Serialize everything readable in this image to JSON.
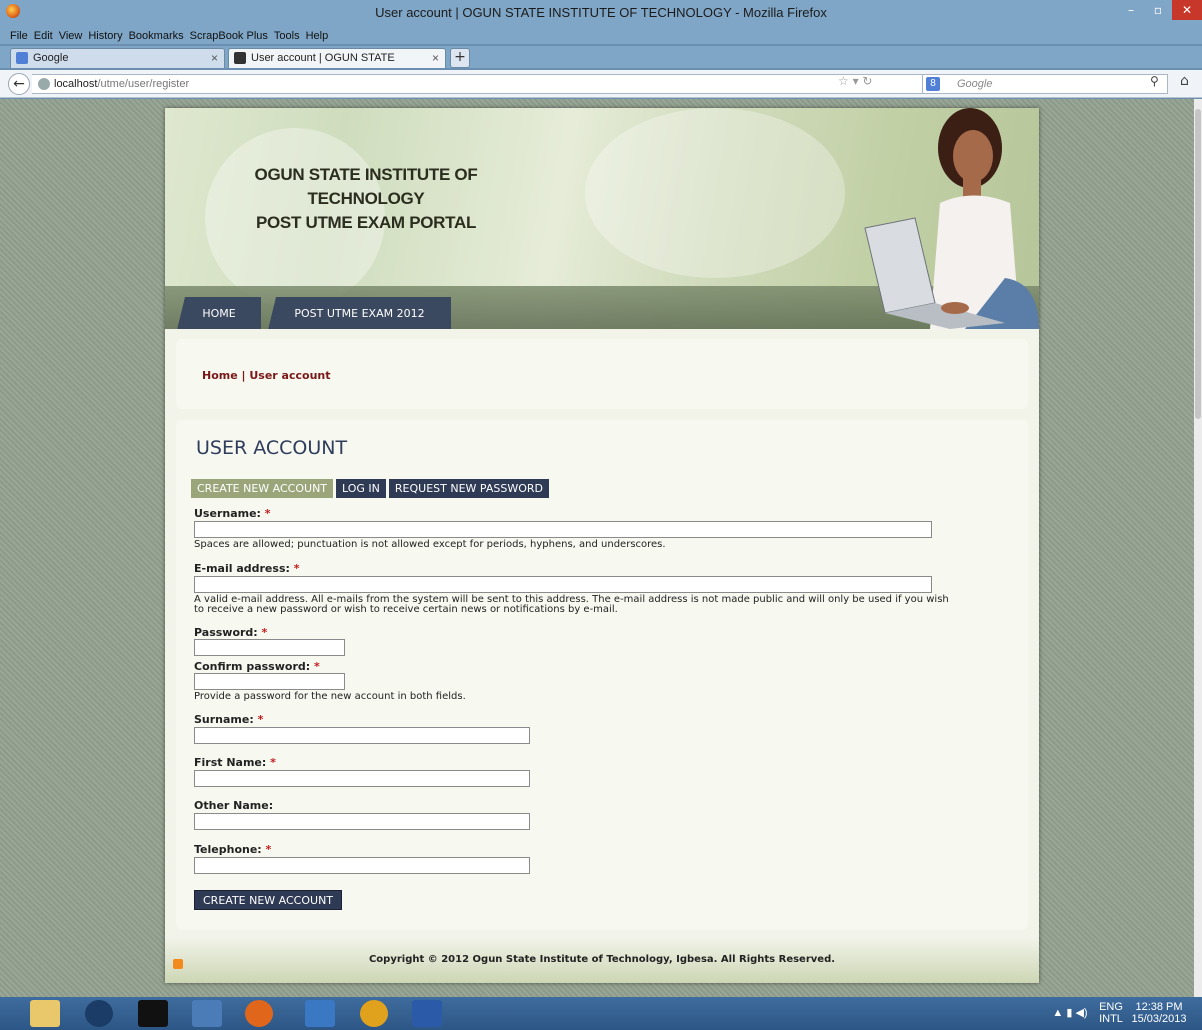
{
  "browser": {
    "window_title": "User account | OGUN STATE INSTITUTE OF TECHNOLOGY - Mozilla Firefox",
    "menu": [
      "File",
      "Edit",
      "View",
      "History",
      "Bookmarks",
      "ScrapBook Plus",
      "Tools",
      "Help"
    ],
    "tabs": [
      {
        "label": "Google",
        "close": "×"
      },
      {
        "label": "User account | OGUN STATE INSTITU...",
        "close": "×"
      }
    ],
    "new_tab": "+",
    "url_host": "localhost",
    "url_path": "/utme/user/register",
    "search_placeholder": "Google",
    "search_engine_icon": "8"
  },
  "site": {
    "title_line1": "OGUN STATE INSTITUTE OF TECHNOLOGY",
    "title_line2": "POST UTME EXAM PORTAL",
    "nav": [
      "HOME",
      "POST UTME EXAM 2012"
    ],
    "breadcrumb": "Home | User account",
    "page_title": "USER ACCOUNT",
    "tabs": [
      "CREATE NEW ACCOUNT",
      "LOG IN",
      "REQUEST NEW PASSWORD"
    ],
    "form": {
      "username_label": "Username:",
      "username_desc": "Spaces are allowed; punctuation is not allowed except for periods, hyphens, and underscores.",
      "email_label": "E-mail address:",
      "email_desc_1": "A valid e-mail address. All e-mails from the system will be sent to this address. The e-mail address is not made public and will only be used if you wish",
      "email_desc_2": "to receive a new password or wish to receive certain news or notifications by e-mail.",
      "password_label": "Password:",
      "confirm_label": "Confirm password:",
      "password_desc": "Provide a password for the new account in both fields.",
      "surname_label": "Surname:",
      "firstname_label": "First Name:",
      "othername_label": "Other Name:",
      "telephone_label": "Telephone:",
      "required_mark": "*",
      "submit": "CREATE NEW ACCOUNT"
    },
    "footer": "Copyright © 2012 Ogun State Institute of Technology, Igbesa. All Rights Reserved."
  },
  "taskbar": {
    "lang": "ENG",
    "layout": "INTL",
    "time": "12:38 PM",
    "date": "15/03/2013"
  },
  "colors": {
    "nav_dark": "#3a4860",
    "tab_selected": "#9aa67a",
    "breadcrumb": "#7a1818",
    "required": "#c21b1b"
  }
}
